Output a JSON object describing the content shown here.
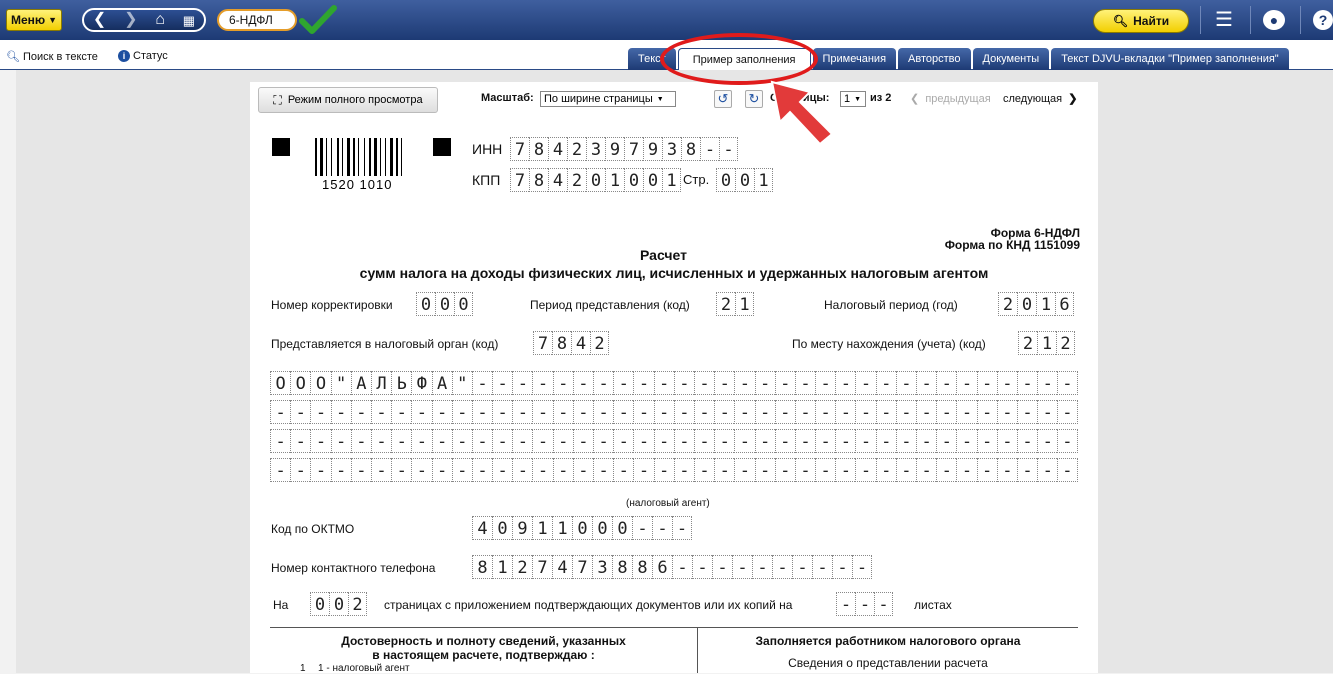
{
  "toolbar": {
    "menu_label": "Меню",
    "doc_name": "6-НДФЛ",
    "find_label": "Найти"
  },
  "subbar": {
    "search_label": "Поиск в тексте",
    "status_label": "Статус"
  },
  "tabs": [
    {
      "label": "Текст"
    },
    {
      "label": "Пример заполнения"
    },
    {
      "label": "Примечания"
    },
    {
      "label": "Авторство"
    },
    {
      "label": "Документы"
    },
    {
      "label": "Текст DJVU-вкладки \"Пример заполнения\""
    }
  ],
  "viewer": {
    "full_view_label": "Режим полного просмотра",
    "scale_label": "Масштаб:",
    "scale_value": "По ширине страницы",
    "pages_label": "Страницы:",
    "page_value": "1",
    "of_label": "из 2",
    "prev_label": "предыдущая",
    "next_label": "следующая"
  },
  "form": {
    "barcode_text": "1520 1010",
    "inn_label": "ИНН",
    "inn": [
      "7",
      "8",
      "4",
      "2",
      "3",
      "9",
      "7",
      "9",
      "3",
      "8",
      "-",
      "-"
    ],
    "kpp_label": "КПП",
    "kpp": [
      "7",
      "8",
      "4",
      "2",
      "0",
      "1",
      "0",
      "0",
      "1"
    ],
    "page_label": "Стр.",
    "page": [
      "0",
      "0",
      "1"
    ],
    "form_name": "Форма 6-НДФЛ",
    "knd": "Форма по КНД 1151099",
    "title": "Расчет",
    "subtitle": "сумм налога на доходы физических лиц, исчисленных и удержанных налоговым агентом",
    "corr_label": "Номер корректировки",
    "corr": [
      "0",
      "0",
      "0"
    ],
    "period_label": "Период представления (код)",
    "period": [
      "2",
      "1"
    ],
    "tax_period_label": "Налоговый период (год)",
    "tax_period": [
      "2",
      "0",
      "1",
      "6"
    ],
    "organ_label": "Представляется в налоговый орган (код)",
    "organ": [
      "7",
      "8",
      "4",
      "2"
    ],
    "location_label": "По месту нахождения (учета) (код)",
    "location": [
      "2",
      "1",
      "2"
    ],
    "name_row1": [
      "О",
      "О",
      "О",
      "\"",
      "А",
      "Л",
      "Ь",
      "Ф",
      "А",
      "\"",
      "-",
      "-",
      "-",
      "-",
      "-",
      "-",
      "-",
      "-",
      "-",
      "-",
      "-",
      "-",
      "-",
      "-",
      "-",
      "-",
      "-",
      "-",
      "-",
      "-",
      "-",
      "-",
      "-",
      "-",
      "-",
      "-",
      "-",
      "-",
      "-",
      "-"
    ],
    "agent_caption": "(налоговый агент)",
    "oktmo_label": "Код по ОКТМО",
    "oktmo": [
      "4",
      "0",
      "9",
      "1",
      "1",
      "0",
      "0",
      "0",
      "-",
      "-",
      "-"
    ],
    "phone_label": "Номер контактного телефона",
    "phone": [
      "8",
      "1",
      "2",
      "7",
      "4",
      "7",
      "3",
      "8",
      "8",
      "6",
      "-",
      "-",
      "-",
      "-",
      "-",
      "-",
      "-",
      "-",
      "-",
      "-"
    ],
    "on_label": "На",
    "pages": [
      "0",
      "0",
      "2"
    ],
    "pages_text": "страницах с приложением подтверждающих документов или их копий на",
    "sheets": [
      "-",
      "-",
      "-"
    ],
    "sheets_label": "листах",
    "confirm_title_1": "Достоверность и полноту сведений, указанных",
    "confirm_title_2": "в настоящем расчете, подтверждаю :",
    "confirm_code": "1",
    "confirm_item": "1 - налоговый агент",
    "inspector_title": "Заполняется работником налогового органа",
    "inspector_sub": "Сведения о представлении расчета"
  }
}
